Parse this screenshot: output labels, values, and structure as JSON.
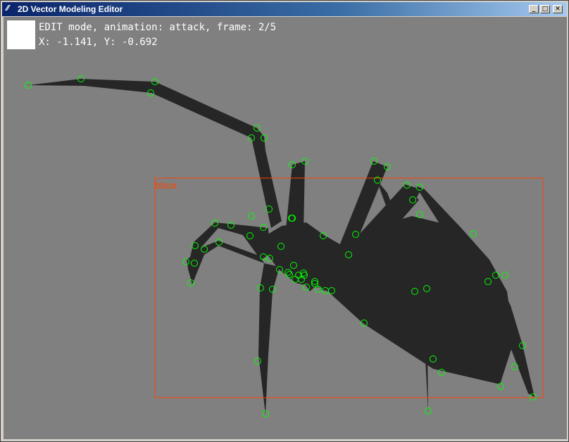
{
  "window": {
    "title": "2D Vector Modeling Editor",
    "icon": "feather-icon",
    "controls": {
      "minimize": "_",
      "maximize": "□",
      "close": "✕"
    }
  },
  "hud": {
    "mode_line": "EDIT mode, animation: attack, frame: 2/5",
    "coords_line": "X: -1.141, Y: -0.692",
    "swatch_color": "#ffffff"
  },
  "bbox": {
    "label": "bbox",
    "color": "#ff4400"
  },
  "colors": {
    "background": "#808080",
    "shape_fill": "#262626",
    "control_point": "#00ff00"
  }
}
